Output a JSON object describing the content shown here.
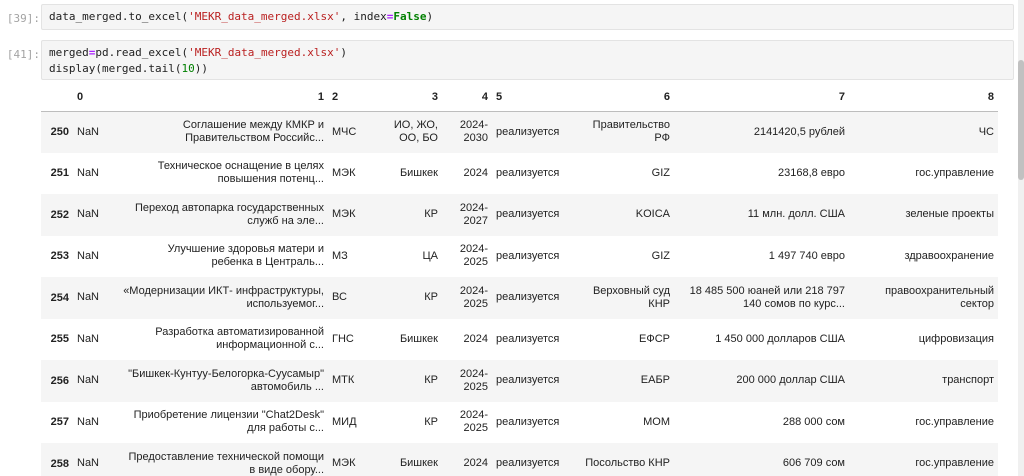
{
  "cells": [
    {
      "prompt": "[39]:",
      "code_parts": {
        "a": "data_merged.to_excel(",
        "b": "'MEKR_data_merged.xlsx'",
        "c": ", index",
        "d": "=",
        "e": "False",
        "f": ")"
      }
    },
    {
      "prompt": "[41]:",
      "line1": {
        "a": "merged",
        "b": "=",
        "c": "pd.read_excel(",
        "d": "'MEKR_data_merged.xlsx'",
        "e": ")"
      },
      "line2": {
        "a": "display(merged.tail(",
        "b": "10",
        "c": "))"
      }
    }
  ],
  "table": {
    "columns": [
      "0",
      "1",
      "2",
      "3",
      "4",
      "5",
      "6",
      "7",
      "8"
    ],
    "rows": [
      {
        "idx": "250",
        "c0": "NaN",
        "c1": [
          "Соглашение между КМКР и",
          "Правительством Российс..."
        ],
        "c2": "МЧС",
        "c3": [
          "ИО, ЖО,",
          "ОО, БО"
        ],
        "c4": [
          "2024-",
          "2030"
        ],
        "c5": "реализуется",
        "c6": [
          "Правительство",
          "РФ"
        ],
        "c7": [
          "2141420,5 рублей"
        ],
        "c8": [
          "ЧС"
        ]
      },
      {
        "idx": "251",
        "c0": "NaN",
        "c1": [
          "Техническое оснащение в целях",
          "повышения потенц..."
        ],
        "c2": "МЭК",
        "c3": [
          "Бишкек"
        ],
        "c4": [
          "2024"
        ],
        "c5": "реализуется",
        "c6": [
          "GIZ"
        ],
        "c7": [
          "23168,8 евро"
        ],
        "c8": [
          "гос.управление"
        ]
      },
      {
        "idx": "252",
        "c0": "NaN",
        "c1": [
          "Переход автопарка государственных",
          "служб на эле..."
        ],
        "c2": "МЭК",
        "c3": [
          "КР"
        ],
        "c4": [
          "2024-",
          "2027"
        ],
        "c5": "реализуется",
        "c6": [
          "KOICA"
        ],
        "c7": [
          "11 млн. долл. США"
        ],
        "c8": [
          "зеленые проекты"
        ]
      },
      {
        "idx": "253",
        "c0": "NaN",
        "c1": [
          "Улучшение здоровья матери и",
          "ребенка в Централь..."
        ],
        "c2": "МЗ",
        "c3": [
          "ЦА"
        ],
        "c4": [
          "2024-",
          "2025"
        ],
        "c5": "реализуется",
        "c6": [
          "GIZ"
        ],
        "c7": [
          "1 497 740 евро"
        ],
        "c8": [
          "здравоохранение"
        ]
      },
      {
        "idx": "254",
        "c0": "NaN",
        "c1": [
          "«Модернизации ИКТ- инфраструктуры,",
          "используемог..."
        ],
        "c2": "ВС",
        "c3": [
          "КР"
        ],
        "c4": [
          "2024-",
          "2025"
        ],
        "c5": "реализуется",
        "c6": [
          "Верховный суд",
          "КНР"
        ],
        "c7": [
          "18 485 500 юаней или 218 797",
          "140 сомов по курс..."
        ],
        "c8": [
          "правоохранительный",
          "сектор"
        ]
      },
      {
        "idx": "255",
        "c0": "NaN",
        "c1": [
          "Разработка автоматизированной",
          "информационной с..."
        ],
        "c2": "ГНС",
        "c3": [
          "Бишкек"
        ],
        "c4": [
          "2024"
        ],
        "c5": "реализуется",
        "c6": [
          "ЕФСР"
        ],
        "c7": [
          "1 450 000 долларов США"
        ],
        "c8": [
          "цифровизация"
        ]
      },
      {
        "idx": "256",
        "c0": "NaN",
        "c1": [
          "\"Бишкек-Кунтуу-Белогорка-Суусамыр\"",
          "автомобиль ..."
        ],
        "c2": "МТК",
        "c3": [
          "КР"
        ],
        "c4": [
          "2024-",
          "2025"
        ],
        "c5": "реализуется",
        "c6": [
          "ЕАБР"
        ],
        "c7": [
          "200 000 доллар США"
        ],
        "c8": [
          "транспорт"
        ]
      },
      {
        "idx": "257",
        "c0": "NaN",
        "c1": [
          "Приобретение лицензии \"Chat2Desk\"",
          "для работы с..."
        ],
        "c2": "МИД",
        "c3": [
          "КР"
        ],
        "c4": [
          "2024-",
          "2025"
        ],
        "c5": "реализуется",
        "c6": [
          "МОМ"
        ],
        "c7": [
          "288 000 сом"
        ],
        "c8": [
          "гос.управление"
        ]
      },
      {
        "idx": "258",
        "c0": "NaN",
        "c1": [
          "Предоставление технической помощи",
          "в виде обору..."
        ],
        "c2": "МЭК",
        "c3": [
          "Бишкек"
        ],
        "c4": [
          "2024"
        ],
        "c5": "реализуется",
        "c6": [
          "Посольство КНР"
        ],
        "c7": [
          "606 709 сом"
        ],
        "c8": [
          "гос.управление"
        ]
      }
    ]
  }
}
